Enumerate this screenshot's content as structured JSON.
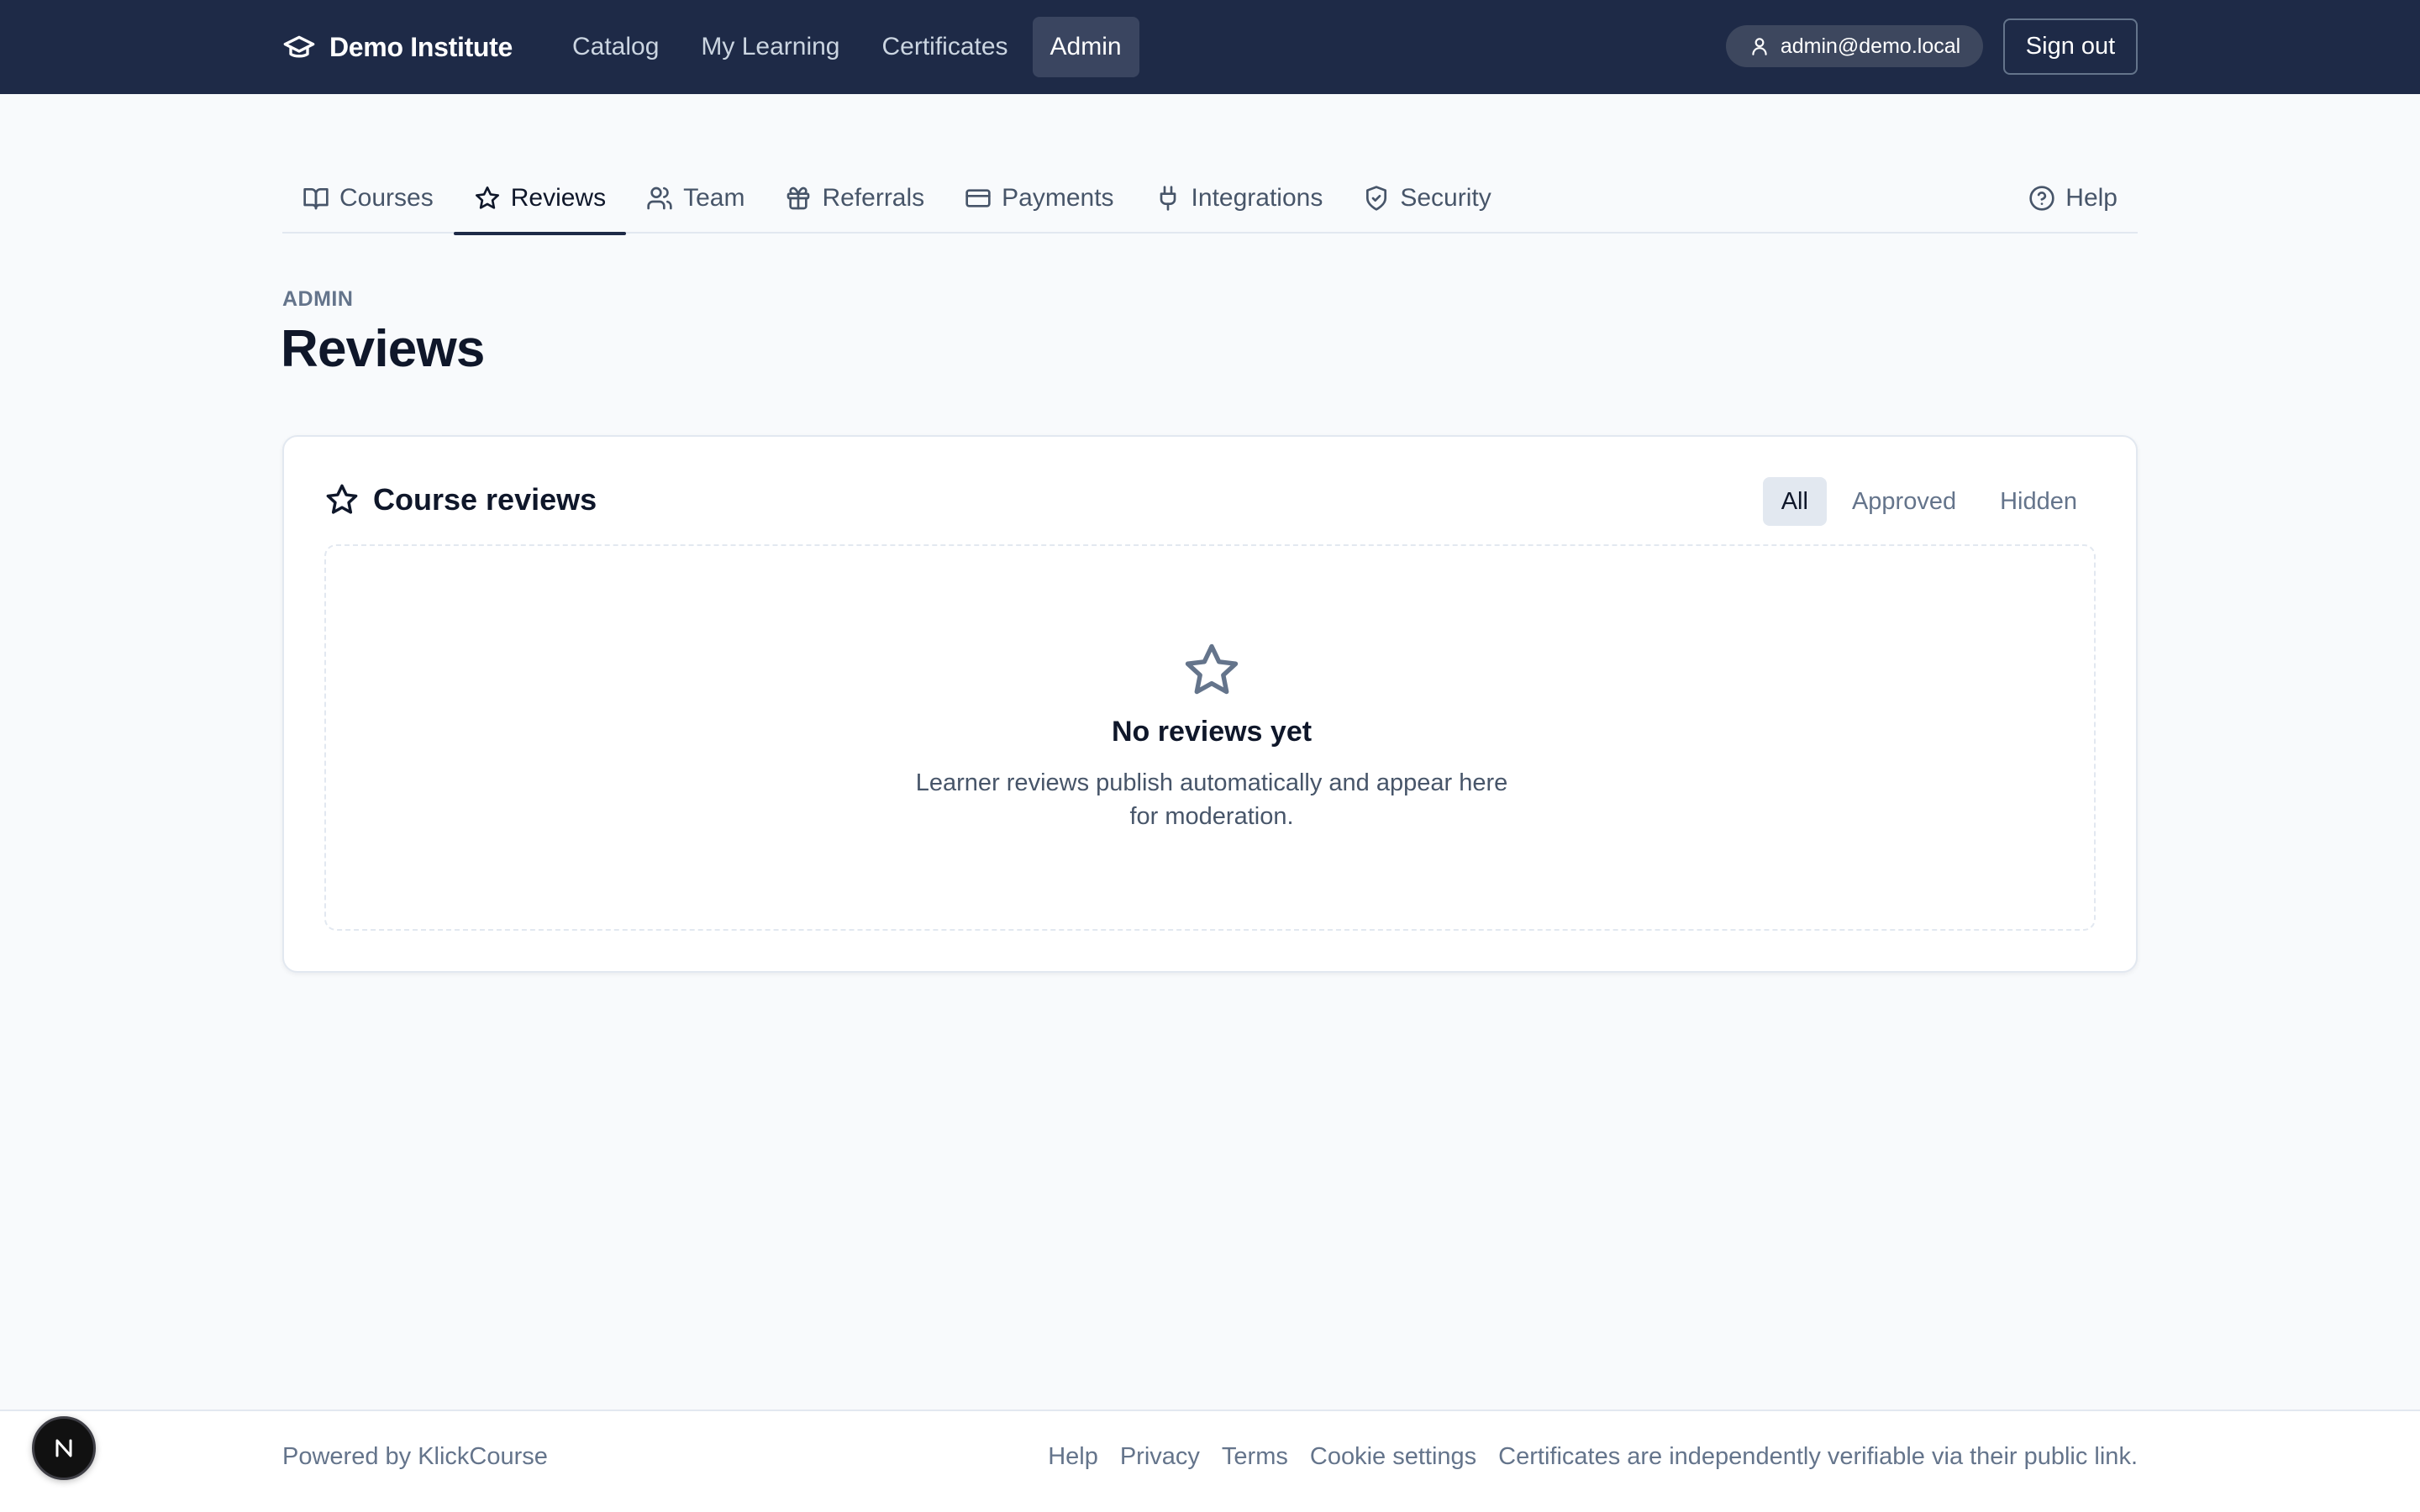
{
  "header": {
    "brand": "Demo Institute",
    "nav": [
      {
        "label": "Catalog",
        "icon": "none"
      },
      {
        "label": "My Learning",
        "icon": "none"
      },
      {
        "label": "Certificates",
        "icon": "none"
      },
      {
        "label": "Admin",
        "active": true
      }
    ],
    "user_email": "admin@demo.local",
    "sign_out": "Sign out"
  },
  "subnav": {
    "items": [
      {
        "label": "Courses",
        "icon": "book-icon"
      },
      {
        "label": "Reviews",
        "icon": "star-icon",
        "active": true
      },
      {
        "label": "Team",
        "icon": "users-icon"
      },
      {
        "label": "Referrals",
        "icon": "gift-icon"
      },
      {
        "label": "Payments",
        "icon": "credit-card-icon"
      },
      {
        "label": "Integrations",
        "icon": "plug-icon"
      },
      {
        "label": "Security",
        "icon": "shield-icon"
      }
    ],
    "help": "Help"
  },
  "page": {
    "eyebrow": "ADMIN",
    "title": "Reviews"
  },
  "card": {
    "title": "Course reviews",
    "filters": [
      {
        "label": "All",
        "active": true
      },
      {
        "label": "Approved"
      },
      {
        "label": "Hidden"
      }
    ],
    "empty": {
      "title": "No reviews yet",
      "description": "Learner reviews publish automatically and appear here for moderation."
    }
  },
  "footer": {
    "powered_by": "Powered by KlickCourse",
    "links": [
      "Help",
      "Privacy",
      "Terms",
      "Cookie settings"
    ],
    "note": "Certificates are independently verifiable via their public link."
  },
  "badge": {
    "letter": "N"
  },
  "colors": {
    "topbar": "#1e2a47",
    "page_bg": "#f8fafc",
    "text_primary": "#0f172a",
    "text_muted": "#64748b",
    "active_tab_bg": "#e2e8f0"
  }
}
